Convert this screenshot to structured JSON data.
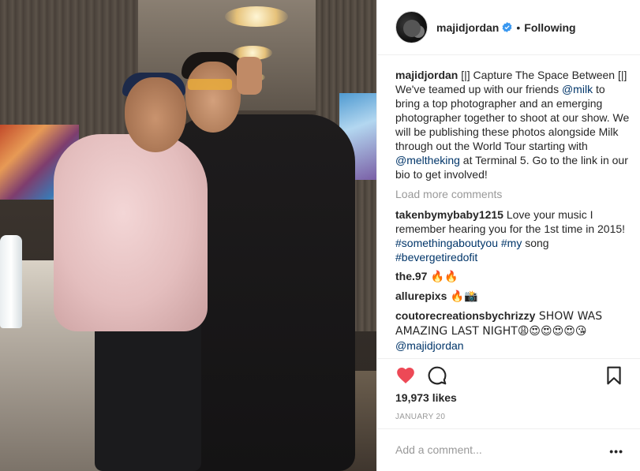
{
  "post": {
    "username": "majidjordan",
    "follow_status": "Following",
    "separator": "•",
    "caption_user": "majidjordan",
    "caption_parts": [
      "[|] Capture The Space Between [|] We've teamed up with our friends ",
      "@milk",
      " to bring a top photographer and an emerging photographer together to shoot at our show. We will be publishing these photos alongside Milk through out the World Tour starting with ",
      "@meltheking",
      " at Terminal 5. Go to the link in our bio to get involved!"
    ],
    "load_more": "Load more comments",
    "comments": [
      {
        "user": "takenbymybaby1215",
        "text": " Love your music I remember hearing you for the 1st time in 2015! ",
        "tag1": "#somethingaboutyou",
        "mid": " ",
        "tag2": "#my",
        "mid2": " song ",
        "tag3": "#bevergetiredofit"
      },
      {
        "user": "the.97",
        "text": " 🔥🔥"
      },
      {
        "user": "allurepixs",
        "text": " 🔥📸"
      },
      {
        "user": "coutorecreationsbychrizzy",
        "text": " SHOW WAS AMAZING LAST NIGHT😩😍😍😍😍😘",
        "mention": "@majidjordan"
      }
    ],
    "likes": "19,973 likes",
    "date": "JANUARY 20",
    "add_comment_placeholder": "Add a comment...",
    "more_label": "•••"
  },
  "icons": [
    "heart-icon",
    "comment-icon",
    "bookmark-icon",
    "verified-badge-icon"
  ],
  "colors": {
    "like": "#ed4956",
    "verified": "#3897f0",
    "link": "#003569",
    "muted": "#999999"
  }
}
